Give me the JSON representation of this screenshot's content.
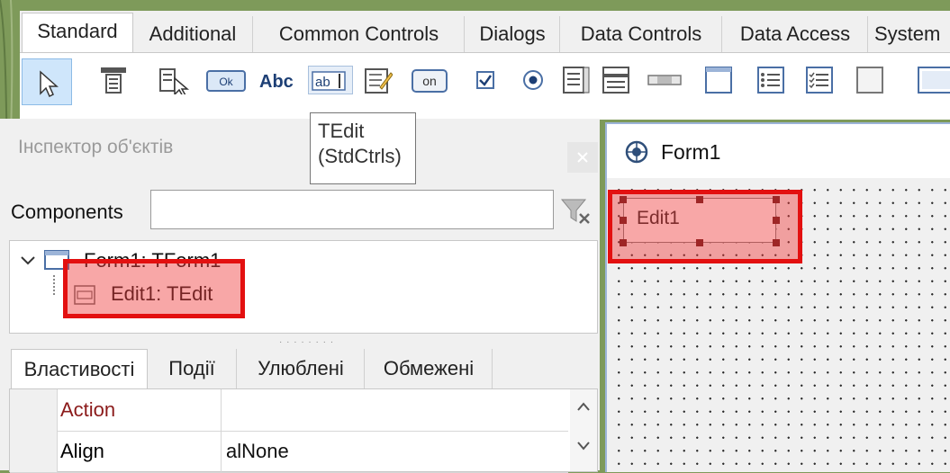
{
  "palette_tabs": [
    "Standard",
    "Additional",
    "Common Controls",
    "Dialogs",
    "Data Controls",
    "Data Access",
    "System"
  ],
  "palette_icons": [
    "pointer-icon",
    "main-menu-icon",
    "popup-menu-icon",
    "button-icon",
    "label-icon",
    "edit-icon",
    "memo-icon",
    "toggle-box-icon",
    "checkbox-icon",
    "radio-button-icon",
    "listbox-icon",
    "combobox-icon",
    "scrollbar-icon",
    "groupbox-icon",
    "radiogroup-icon",
    "checkgroup-icon",
    "panel-icon",
    "frame-icon"
  ],
  "palette_texts": {
    "ok": "Ok",
    "abc": "Abc",
    "ab": "ab",
    "on": "on"
  },
  "tooltip": {
    "line1": "TEdit",
    "line2": "(StdCtrls)"
  },
  "inspector": {
    "title": "Інспектор об'єктів",
    "components_label": "Components",
    "components_value": "",
    "tree": [
      {
        "label": "Form1: TForm1"
      },
      {
        "label": "Edit1: TEdit"
      }
    ],
    "tabs": [
      "Властивості",
      "Події",
      "Улюблені",
      "Обмежені"
    ],
    "properties": [
      {
        "name": "Action",
        "value": ""
      },
      {
        "name": "Align",
        "value": "alNone"
      }
    ]
  },
  "form": {
    "title": "Form1",
    "edit_text": "Edit1"
  },
  "colors": {
    "highlight": "#e31010",
    "property_name_red": "#8b1a1a",
    "background": "#7e9a5a"
  }
}
